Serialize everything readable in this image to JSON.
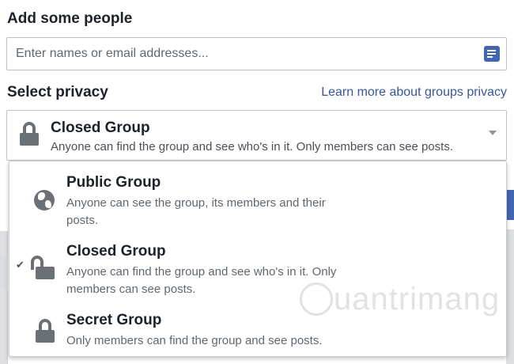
{
  "add_people": {
    "title": "Add some people",
    "placeholder": "Enter names or email addresses...",
    "icon": "contacts-book-icon",
    "icon_color": "#4267b2"
  },
  "privacy": {
    "title": "Select privacy",
    "learn_more": "Learn more about groups privacy",
    "selected": {
      "title": "Closed Group",
      "desc": "Anyone can find the group and see who's in it. Only members can see posts.",
      "icon": "lock-icon"
    },
    "options": [
      {
        "title": "Public Group",
        "desc": "Anyone can see the group, its members and their posts.",
        "icon": "globe-icon",
        "checked": false
      },
      {
        "title": "Closed Group",
        "desc": "Anyone can find the group and see who's in it. Only members can see posts.",
        "icon": "open-lock-icon",
        "checked": true
      },
      {
        "title": "Secret Group",
        "desc": "Only members can find the group and see posts.",
        "icon": "lock-icon",
        "checked": false
      }
    ],
    "check_mark": "✔"
  },
  "watermark": "uantrimang",
  "colors": {
    "text": "#1d2129",
    "link": "#365899",
    "muted": "#606770",
    "icon_gray": "#6b6f76",
    "accent": "#4267b2"
  }
}
